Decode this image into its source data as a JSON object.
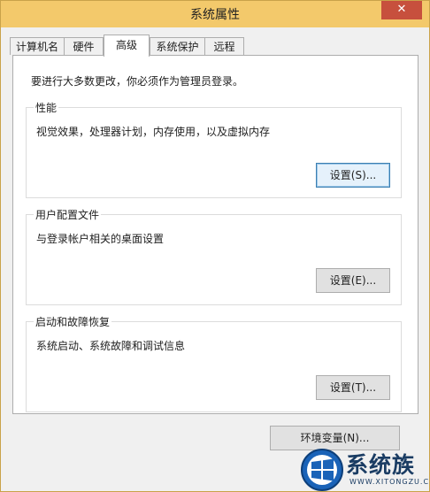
{
  "window": {
    "title": "系统属性",
    "close_glyph": "✕"
  },
  "tabs": [
    {
      "label": "计算机名",
      "active": false
    },
    {
      "label": "硬件",
      "active": false
    },
    {
      "label": "高级",
      "active": true
    },
    {
      "label": "系统保护",
      "active": false
    },
    {
      "label": "远程",
      "active": false
    }
  ],
  "advanced": {
    "intro": "要进行大多数更改，你必须作为管理员登录。",
    "performance": {
      "title": "性能",
      "description": "视觉效果，处理器计划，内存使用，以及虚拟内存",
      "button": "设置(S)..."
    },
    "user_profiles": {
      "title": "用户配置文件",
      "description": "与登录帐户相关的桌面设置",
      "button": "设置(E)..."
    },
    "startup_recovery": {
      "title": "启动和故障恢复",
      "description": "系统启动、系统故障和调试信息",
      "button": "设置(T)..."
    }
  },
  "env_button": "环境变量(N)...",
  "watermark": {
    "text": "系统族",
    "url": "WWW.XITONGZU.COM",
    "icon": "windows-logo-icon"
  },
  "colors": {
    "titlebar": "#f3c96b",
    "close": "#c7503d",
    "focus_border": "#3c7fb1"
  }
}
